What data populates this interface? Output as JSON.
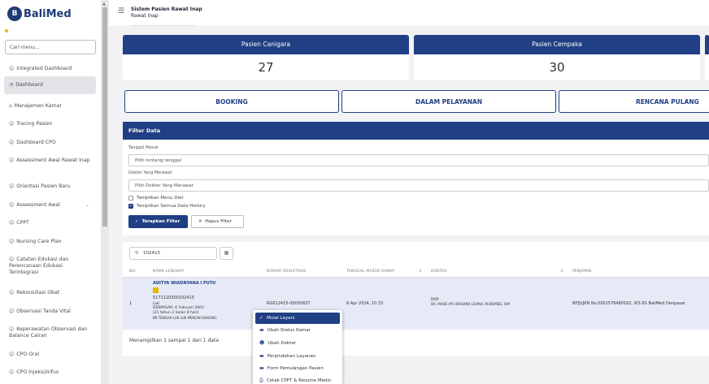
{
  "sidebar": {
    "logo_text": "BaliMed",
    "search_placeholder": "Cari menu...",
    "items": [
      {
        "label": "Integrated Dashboard",
        "icon": "person"
      },
      {
        "label": "Dashboard",
        "icon": "gauge",
        "active": true
      },
      {
        "label": "Manajemen Kamar",
        "icon": "home"
      },
      {
        "label": "Tracing Pasien",
        "icon": "person"
      },
      {
        "label": "Dashboard CPO",
        "icon": "person"
      },
      {
        "label": "Assessment Awal Rawat Inap",
        "icon": "person"
      },
      {
        "label": "Orientasi Pasien Baru",
        "icon": "person"
      },
      {
        "label": "Assessment Awal",
        "icon": "person",
        "chevron": true
      },
      {
        "label": "CPPT",
        "icon": "person"
      },
      {
        "label": "Nursing Care Plan",
        "icon": "person"
      },
      {
        "label": "Catatan Edukasi dan Perencanaan Edukasi Terintegrasi",
        "icon": "person"
      },
      {
        "label": "Rekonsiliasi Obat",
        "icon": "person"
      },
      {
        "label": "Observasi Tanda Vital",
        "icon": "person"
      },
      {
        "label": "Keperawatan Observasi dan Balance Cairan",
        "icon": "person"
      },
      {
        "label": "CPO Oral",
        "icon": "person"
      },
      {
        "label": "CPO Injeksi/Infus",
        "icon": "person"
      }
    ]
  },
  "header": {
    "title": "Sistem Pasien Rawat Inap",
    "subtitle": "Rawat Inap"
  },
  "stats": [
    {
      "label": "Pasien Canigara",
      "value": "27"
    },
    {
      "label": "Pasien Cempaka",
      "value": "30"
    }
  ],
  "tabs": [
    "BOOKING",
    "DALAM PELAYANAN",
    "RENCANA PULANG"
  ],
  "filter": {
    "title": "Filter Data",
    "date_label": "Tanggal Masuk",
    "date_placeholder": "Pilih rentang tanggal",
    "doctor_label": "Dokter Yang Merawat",
    "doctor_placeholder": "Pilih Dokter Yang Merawat",
    "check_diet": "Tampilkan Menu Diet",
    "check_history": "Tampilkan Semua Data History",
    "apply_label": "Terapkan Filter",
    "reset_label": "Hapus Filter"
  },
  "table": {
    "search_value": "102415",
    "columns": [
      "NO.",
      "NAMA LENGKAP",
      "NOMOR REGISTRASI",
      "TANGGAL MASUK RANAP",
      "DOKTER",
      "PENJAMIN"
    ],
    "row": {
      "no": "1",
      "name": "ADITYA WIADNYANA I PUTU",
      "rm": "5171120300102415",
      "sex": "Laki",
      "birth": "DENPASAR, 6 Februari 2003",
      "age": "(21 tahun 2 bulan 8 hari)",
      "address": "BR TENGAH LUK LUK MENGWI BADUNG",
      "reg": "RG012415-00050837",
      "date": "6 Apr 2024, 10.33",
      "dpjp_label": "DPJP:",
      "doctor": "DR. MADE AYU KRISHNA LEVINA, M.BIOMED, SPA",
      "guarantor": "BPJS/JKN No.0001576480162, IKS RS BaliMed Denpasar"
    },
    "footer": "Menampilkan 1 sampai 1 dari 1 data"
  },
  "dropdown": [
    {
      "label": "Mulai Layani",
      "icon": "check"
    },
    {
      "label": "Ubah Status Kamar",
      "icon": "bed"
    },
    {
      "label": "Ubah Dokter",
      "icon": "people"
    },
    {
      "label": "Perpindahan Layanan",
      "icon": "bed"
    },
    {
      "label": "Form Pemulangan Pasien",
      "icon": "bed"
    },
    {
      "label": "Cetak CPPT & Resume Medis",
      "icon": "print"
    }
  ]
}
